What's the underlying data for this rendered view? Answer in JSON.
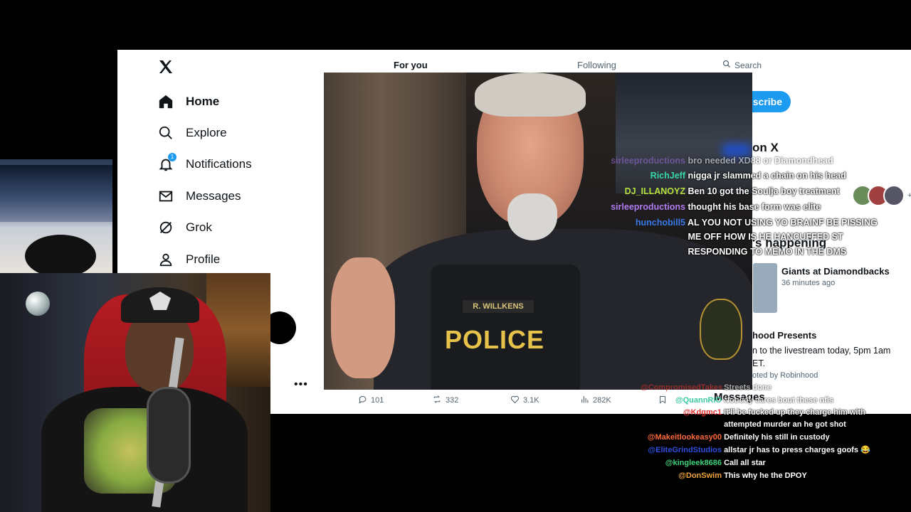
{
  "x_app": {
    "nav": [
      {
        "label": "Home",
        "icon": "home-icon",
        "active": true
      },
      {
        "label": "Explore",
        "icon": "search-icon",
        "active": false
      },
      {
        "label": "Notifications",
        "icon": "bell-icon",
        "active": false,
        "badge": "1"
      },
      {
        "label": "Messages",
        "icon": "envelope-icon",
        "active": false
      },
      {
        "label": "Grok",
        "icon": "grok-icon",
        "active": false
      },
      {
        "label": "Profile",
        "icon": "person-icon",
        "active": false
      }
    ],
    "tabs": {
      "for_you": "For you",
      "following": "Following"
    },
    "search_placeholder": "Search",
    "subscribe_label": "scribe",
    "live_on_x": "on X",
    "whats_happening": "'s happening",
    "trend": {
      "title": "Giants at Diamondbacks",
      "time": "36 minutes ago"
    },
    "promo": {
      "title": "hood Presents",
      "text": "n to the livestream today, 5pm 1am ET.",
      "by": "oted by Robinhood"
    },
    "messages_label": "Messages",
    "avatar_more": "+4",
    "more_dots": "•••"
  },
  "video": {
    "nameplate": "R. WILLKENS",
    "patch_text": "POLICE"
  },
  "tweet_actions": {
    "replies": "101",
    "reposts": "332",
    "likes": "3.1K",
    "views": "282K"
  },
  "top_chat": [
    {
      "user": "sirleeproductions",
      "color": "#9a6bdc",
      "msg": "bro needed XD88 or Diamondhead",
      "faded": true
    },
    {
      "user": "RichJeff",
      "color": "#35d6a7",
      "msg": "nigga jr slammed a chain on his head"
    },
    {
      "user": "DJ_ILLANOYZ",
      "color": "#b6e03c",
      "msg": "Ben 10 got the Soulja boy treatment"
    },
    {
      "user": "sirleeproductions",
      "color": "#b07cf0",
      "msg": "thought his base form was elite"
    },
    {
      "user": "hunchobill5",
      "color": "#3a78e8",
      "msg": "AL YOU NOT USING YO BRAINF BE PISSING"
    },
    {
      "user": "",
      "color": "#fff",
      "msg": "ME OFF HOW IS HE HANCUFFED ST"
    },
    {
      "user": "",
      "color": "#fff",
      "msg": "RESPONDING TO MEMO IN THE DMS"
    }
  ],
  "bottom_chat": [
    {
      "user": "@CompromisedTakes",
      "color": "#e0302c",
      "msg": "Streets done"
    },
    {
      "user": "@QuannRiO",
      "color": "#39c9a0",
      "msg": "Nobody cares bout these nfls"
    },
    {
      "user": "@Kdgmc1",
      "color": "#e0302c",
      "msg": "It'll be fucked up they charge him with"
    },
    {
      "user": "",
      "color": "#fff",
      "msg": "attempted murder an he got shot"
    },
    {
      "user": "@Makeitlookeasy00",
      "color": "#ff6a3c",
      "msg": "Definitely his still in custody"
    },
    {
      "user": "@EliteGrindStudios",
      "color": "#2f4fe0",
      "msg": "allstar jr has to press charges goofs 😂"
    },
    {
      "user": "@kingleek8686",
      "color": "#3ed17a",
      "msg": "Call all star"
    },
    {
      "user": "@DonSwim",
      "color": "#f0a23c",
      "msg": "This why he the DPOY"
    }
  ]
}
